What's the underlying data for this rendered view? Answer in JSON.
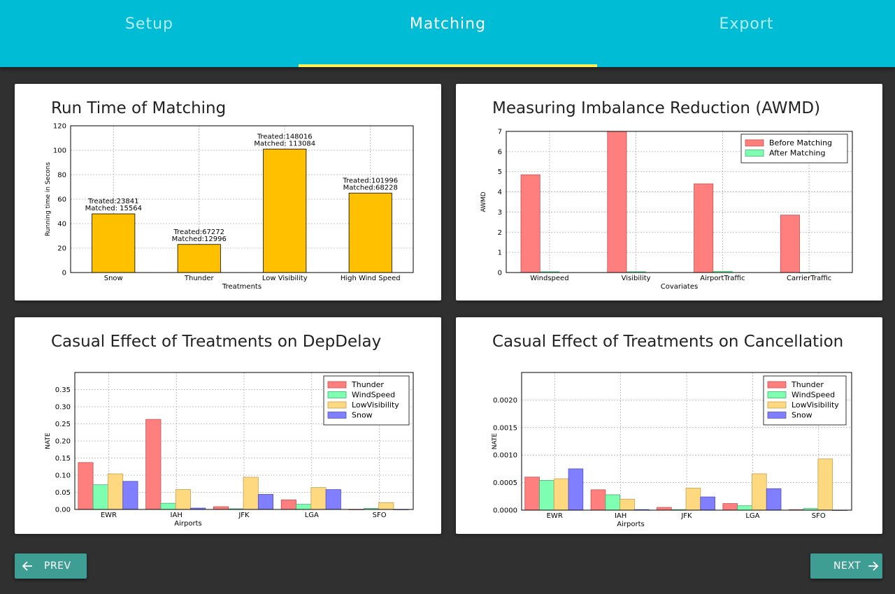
{
  "tabs": [
    {
      "label": "Setup",
      "active": false
    },
    {
      "label": "Matching",
      "active": true
    },
    {
      "label": "Export",
      "active": false
    }
  ],
  "colors": {
    "accent": "#00bcd4",
    "ink": "#ffee58",
    "button": "#3f9e93",
    "background": "#303030",
    "bar_orange": "#ffc000",
    "red": "#ff7f7f",
    "green": "#7fffb2",
    "yellow": "#ffd980",
    "blue": "#7f7fff"
  },
  "cards": [
    {
      "title": "Run Time of Matching"
    },
    {
      "title": "Measuring Imbalance Reduction (AWMD)"
    },
    {
      "title": "Casual Effect of Treatments on DepDelay"
    },
    {
      "title": "Casual Effect of Treatments on Cancellation"
    }
  ],
  "buttons": {
    "prev": {
      "label": "PREV",
      "icon": "arrow-left-icon"
    },
    "next": {
      "label": "NEXT",
      "icon": "arrow-right-icon"
    }
  },
  "chart_data": [
    {
      "type": "bar",
      "title": "Run Time of Matching",
      "xlabel": "Treatments",
      "ylabel": "Running time in Secons",
      "ylim": [
        0,
        120
      ],
      "yticks": [
        0,
        20,
        40,
        60,
        80,
        100,
        120
      ],
      "grid": true,
      "categories": [
        "Snow",
        "Thunder",
        "Low Visibility",
        "High Wind Speed"
      ],
      "values": [
        48,
        23,
        101,
        65
      ],
      "annotations": [
        [
          "Treated:23841",
          "Matched: 15564"
        ],
        [
          "Treated:67272",
          "Matched:12996"
        ],
        [
          "Treated:148016",
          "Matched: 113084"
        ],
        [
          "Treated:101996",
          "Matched:68228"
        ]
      ]
    },
    {
      "type": "bar",
      "title": "Measuring Imbalance Reduction (AWMD)",
      "xlabel": "Covariates",
      "ylabel": "AWMD",
      "ylim": [
        0,
        7
      ],
      "yticks": [
        0,
        1,
        2,
        3,
        4,
        5,
        6,
        7
      ],
      "grid": true,
      "legend": "top-right",
      "categories": [
        "Windspeed",
        "Visibility",
        "AirportTraffic",
        "CarrierTraffic"
      ],
      "series": [
        {
          "name": "Before Matching",
          "values": [
            4.85,
            7.0,
            4.4,
            2.85
          ]
        },
        {
          "name": "After Matching",
          "values": [
            0.04,
            0.04,
            0.06,
            0.0
          ]
        }
      ]
    },
    {
      "type": "bar",
      "title": "Casual Effect of Treatments on DepDelay",
      "xlabel": "Airports",
      "ylabel": "NATE",
      "ylim": [
        0,
        0.4
      ],
      "yticks": [
        0.0,
        0.05,
        0.1,
        0.15,
        0.2,
        0.25,
        0.3,
        0.35
      ],
      "ytick_labels": [
        "0.00",
        "0.05",
        "0.10",
        "0.15",
        "0.20",
        "0.25",
        "0.30",
        "0.35"
      ],
      "grid": true,
      "legend": "top-right",
      "categories": [
        "EWR",
        "IAH",
        "JFK",
        "LGA",
        "SFO"
      ],
      "series": [
        {
          "name": "Thunder",
          "values": [
            0.137,
            0.263,
            0.008,
            0.028,
            0.0
          ]
        },
        {
          "name": "WindSpeed",
          "values": [
            0.072,
            0.018,
            0.002,
            0.015,
            0.003
          ]
        },
        {
          "name": "LowVisibility",
          "values": [
            0.104,
            0.058,
            0.094,
            0.064,
            0.02
          ]
        },
        {
          "name": "Snow",
          "values": [
            0.082,
            0.004,
            0.044,
            0.058,
            0.0
          ]
        }
      ]
    },
    {
      "type": "bar",
      "title": "Casual Effect of Treatments on Cancellation",
      "xlabel": "Airports",
      "ylabel": "NATE",
      "ylim": [
        0,
        0.0025
      ],
      "yticks": [
        0.0,
        0.0005,
        0.001,
        0.0015,
        0.002
      ],
      "ytick_labels": [
        "0.0000",
        "0.0005",
        "0.0010",
        "0.0015",
        "0.0020"
      ],
      "grid": true,
      "legend": "top-right",
      "categories": [
        "EWR",
        "IAH",
        "JFK",
        "LGA",
        "SFO"
      ],
      "series": [
        {
          "name": "Thunder",
          "values": [
            0.0006,
            0.00037,
            5e-05,
            0.00012,
            1e-05
          ]
        },
        {
          "name": "WindSpeed",
          "values": [
            0.00054,
            0.00028,
            1e-05,
            8e-05,
            3e-05
          ]
        },
        {
          "name": "LowVisibility",
          "values": [
            0.00057,
            0.0002,
            0.0004,
            0.00066,
            0.00093
          ]
        },
        {
          "name": "Snow",
          "values": [
            0.00075,
            1e-05,
            0.00024,
            0.00039,
            0.0
          ]
        }
      ]
    }
  ]
}
